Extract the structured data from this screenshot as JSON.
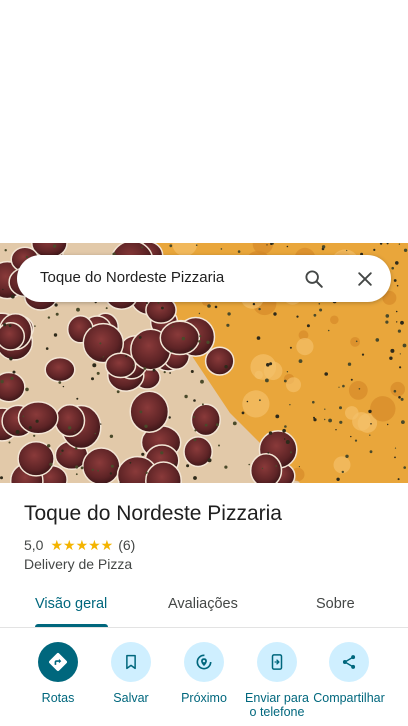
{
  "search": {
    "query": "Toque do Nordeste Pizzaria"
  },
  "place": {
    "name": "Toque do Nordeste Pizzaria",
    "rating": "5,0",
    "stars": "★★★★★",
    "review_count": "(6)",
    "category": "Delivery de Pizza"
  },
  "tabs": [
    {
      "label": "Visão geral",
      "active": true
    },
    {
      "label": "Avaliações",
      "active": false
    },
    {
      "label": "Sobre",
      "active": false
    }
  ],
  "actions": [
    {
      "label": "Rotas",
      "icon": "directions-icon"
    },
    {
      "label": "Salvar",
      "icon": "bookmark-icon"
    },
    {
      "label": "Próximo",
      "icon": "nearby-icon"
    },
    {
      "label": "Enviar para o telefone",
      "icon": "send-to-phone-icon"
    },
    {
      "label": "Compartilhar",
      "icon": "share-icon"
    }
  ],
  "colors": {
    "accent": "#00677d",
    "action_bg": "#cfefff",
    "stars": "#f4b400"
  }
}
